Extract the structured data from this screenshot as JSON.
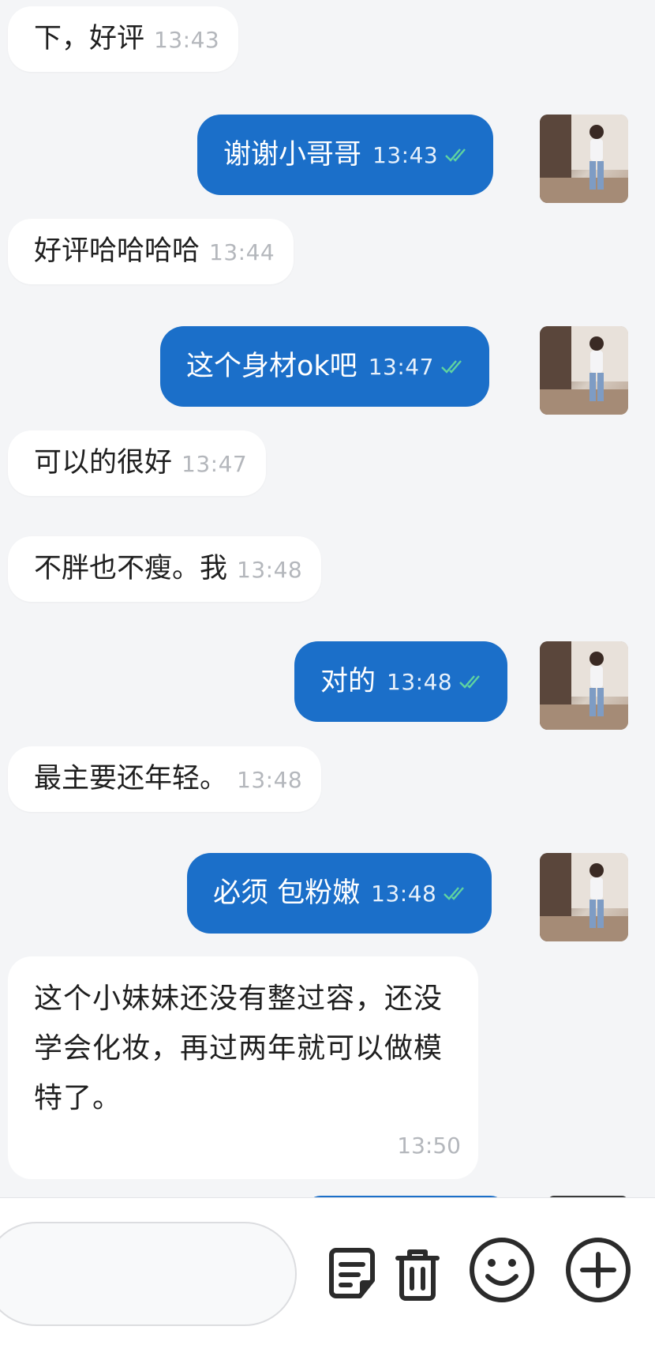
{
  "messages": [
    {
      "direction": "incoming",
      "text": "下，好评",
      "time": "13:43"
    },
    {
      "direction": "outgoing",
      "text": "谢谢小哥哥",
      "time": "13:43",
      "status": "read"
    },
    {
      "direction": "incoming",
      "text": "好评哈哈哈哈",
      "time": "13:44"
    },
    {
      "direction": "outgoing",
      "text": "这个身材ok吧",
      "time": "13:47",
      "status": "read"
    },
    {
      "direction": "incoming",
      "text": "可以的很好",
      "time": "13:47"
    },
    {
      "direction": "incoming",
      "text": "不胖也不瘦。我",
      "time": "13:48"
    },
    {
      "direction": "outgoing",
      "text": "对的",
      "time": "13:48",
      "status": "read"
    },
    {
      "direction": "incoming",
      "text": "最主要还年轻。",
      "time": "13:48"
    },
    {
      "direction": "outgoing",
      "text": "必须 包粉嫩",
      "time": "13:48",
      "status": "read"
    },
    {
      "direction": "incoming",
      "text": "这个小妹妹还没有整过容，还没学会化妆，再过两年就可以做模特了。",
      "time": "13:50"
    }
  ],
  "colors": {
    "outgoing_bubble": "#1b6fc9",
    "incoming_bubble": "#ffffff",
    "background": "#f4f5f7",
    "read_check": "#5fd3a0"
  },
  "toolbar": {
    "icons": [
      "note-icon",
      "trash-icon",
      "emoji-icon",
      "plus-circle-icon"
    ]
  }
}
